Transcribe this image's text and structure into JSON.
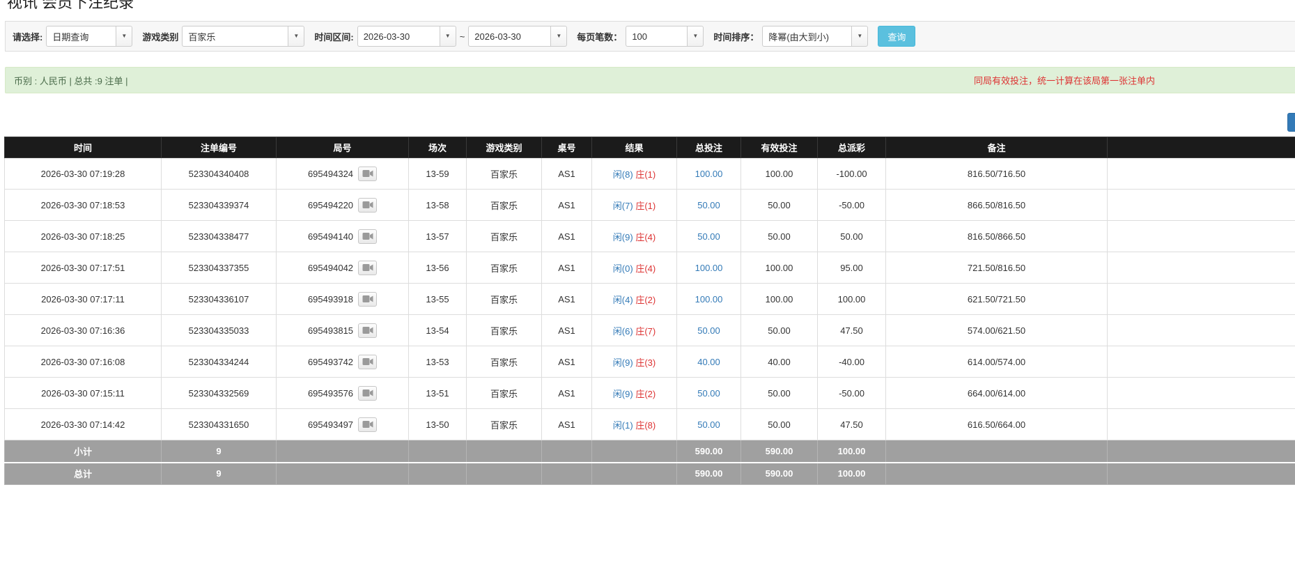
{
  "page": {
    "title": "视讯 会员下注纪录"
  },
  "filter_bar": {
    "select_label": "请选择:",
    "select_value": "日期查询",
    "game_label": "游戏类别",
    "game_value": "百家乐",
    "range_label": "时间区间:",
    "date_from": "2026-03-30",
    "range_separator": "~",
    "date_to": "2026-03-30",
    "per_page_label": "每页笔数：",
    "per_page_value": "100",
    "sort_label": "时间排序：",
    "sort_value": "降幂(由大到小)",
    "search_button_label": "查询"
  },
  "summary_bar": {
    "currency_text": "币别 : 人民币 | 总共 :9 注单 |",
    "notice_text": "同局有效投注，统一计算在该局第一张注单内"
  },
  "colors": {
    "accent_blue": "#337ab7",
    "negative_red": "#dd3333",
    "table_header_bg": "#1b1b1b",
    "table_footer_bg": "#a0a0a0",
    "summary_bg": "#dff0d8",
    "search_button_teal": "#5bc0de"
  },
  "table": {
    "headers": [
      "时间",
      "注单编号",
      "局号",
      "场次",
      "游戏类别",
      "桌号",
      "结果",
      "总投注",
      "有效投注",
      "总派彩",
      "备注",
      ""
    ],
    "rows": [
      {
        "time": "2026-03-30 07:19:28",
        "bet_id": "523304340408",
        "round_id": "695494324",
        "session": "13-59",
        "game": "百家乐",
        "table_no": "AS1",
        "result_player": "闲(8)",
        "result_banker": "庄(1)",
        "total_bet": "100.00",
        "valid_bet": "100.00",
        "payout": "-100.00",
        "note": "816.50/716.50"
      },
      {
        "time": "2026-03-30 07:18:53",
        "bet_id": "523304339374",
        "round_id": "695494220",
        "session": "13-58",
        "game": "百家乐",
        "table_no": "AS1",
        "result_player": "闲(7)",
        "result_banker": "庄(1)",
        "total_bet": "50.00",
        "valid_bet": "50.00",
        "payout": "-50.00",
        "note": "866.50/816.50"
      },
      {
        "time": "2026-03-30 07:18:25",
        "bet_id": "523304338477",
        "round_id": "695494140",
        "session": "13-57",
        "game": "百家乐",
        "table_no": "AS1",
        "result_player": "闲(9)",
        "result_banker": "庄(4)",
        "total_bet": "50.00",
        "valid_bet": "50.00",
        "payout": "50.00",
        "note": "816.50/866.50"
      },
      {
        "time": "2026-03-30 07:17:51",
        "bet_id": "523304337355",
        "round_id": "695494042",
        "session": "13-56",
        "game": "百家乐",
        "table_no": "AS1",
        "result_player": "闲(0)",
        "result_banker": "庄(4)",
        "total_bet": "100.00",
        "valid_bet": "100.00",
        "payout": "95.00",
        "note": "721.50/816.50"
      },
      {
        "time": "2026-03-30 07:17:11",
        "bet_id": "523304336107",
        "round_id": "695493918",
        "session": "13-55",
        "game": "百家乐",
        "table_no": "AS1",
        "result_player": "闲(4)",
        "result_banker": "庄(2)",
        "total_bet": "100.00",
        "valid_bet": "100.00",
        "payout": "100.00",
        "note": "621.50/721.50"
      },
      {
        "time": "2026-03-30 07:16:36",
        "bet_id": "523304335033",
        "round_id": "695493815",
        "session": "13-54",
        "game": "百家乐",
        "table_no": "AS1",
        "result_player": "闲(6)",
        "result_banker": "庄(7)",
        "total_bet": "50.00",
        "valid_bet": "50.00",
        "payout": "47.50",
        "note": "574.00/621.50"
      },
      {
        "time": "2026-03-30 07:16:08",
        "bet_id": "523304334244",
        "round_id": "695493742",
        "session": "13-53",
        "game": "百家乐",
        "table_no": "AS1",
        "result_player": "闲(9)",
        "result_banker": "庄(3)",
        "total_bet": "40.00",
        "valid_bet": "40.00",
        "payout": "-40.00",
        "note": "614.00/574.00"
      },
      {
        "time": "2026-03-30 07:15:11",
        "bet_id": "523304332569",
        "round_id": "695493576",
        "session": "13-51",
        "game": "百家乐",
        "table_no": "AS1",
        "result_player": "闲(9)",
        "result_banker": "庄(2)",
        "total_bet": "50.00",
        "valid_bet": "50.00",
        "payout": "-50.00",
        "note": "664.00/614.00"
      },
      {
        "time": "2026-03-30 07:14:42",
        "bet_id": "523304331650",
        "round_id": "695493497",
        "session": "13-50",
        "game": "百家乐",
        "table_no": "AS1",
        "result_player": "闲(1)",
        "result_banker": "庄(8)",
        "total_bet": "50.00",
        "valid_bet": "50.00",
        "payout": "47.50",
        "note": "616.50/664.00"
      }
    ],
    "subtotal": {
      "label": "小计",
      "count": "9",
      "total_bet": "590.00",
      "valid_bet": "590.00",
      "payout": "100.00"
    },
    "total": {
      "label": "总计",
      "count": "9",
      "total_bet": "590.00",
      "valid_bet": "590.00",
      "payout": "100.00"
    }
  }
}
